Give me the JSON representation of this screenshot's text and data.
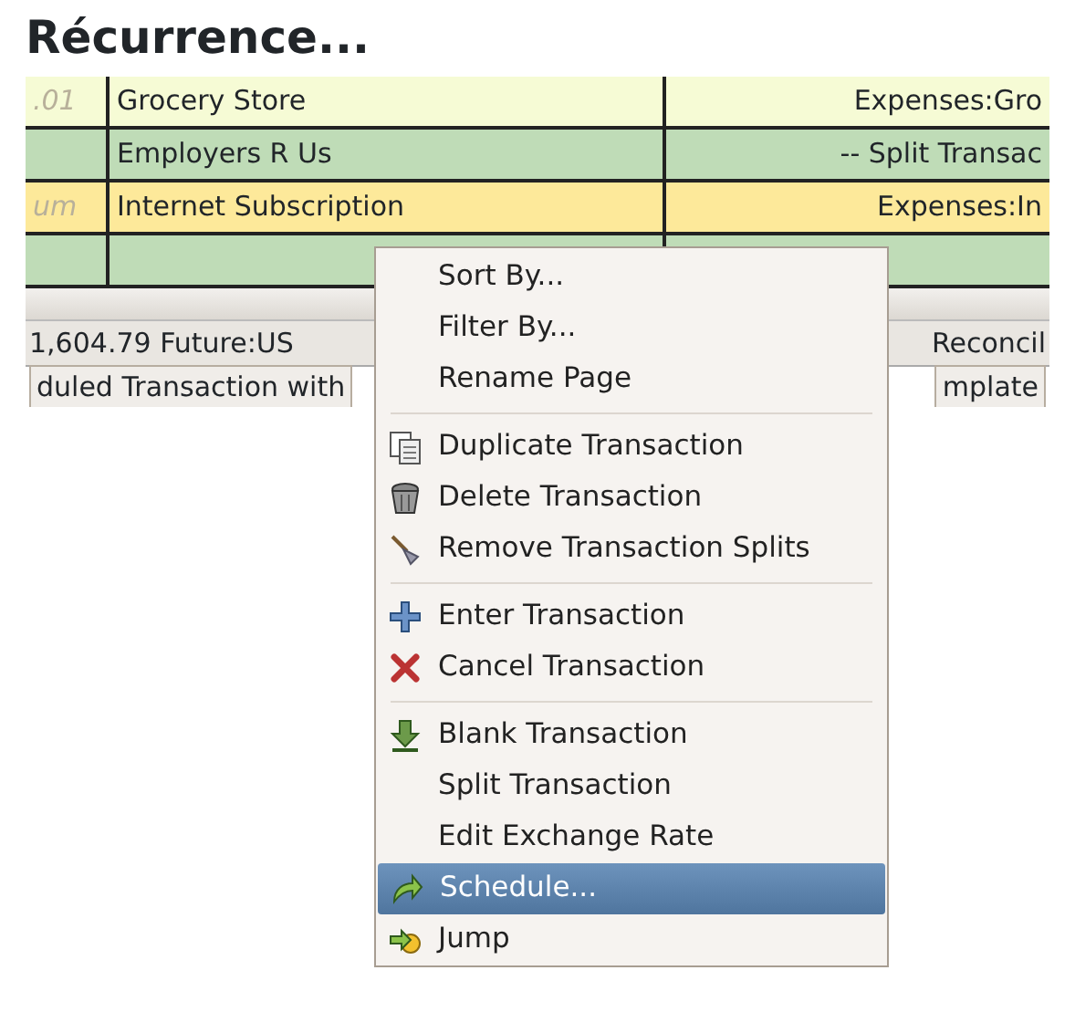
{
  "heading": "Récurrence...",
  "register": {
    "rows": [
      {
        "cells": [
          ".01",
          "Grocery Store",
          "Expenses:Gro"
        ],
        "selected": false
      },
      {
        "cells": [
          "",
          "Employers R Us",
          "-- Split Transac"
        ],
        "selected": false
      },
      {
        "cells": [
          "um",
          "Internet Subscription",
          "Expenses:In"
        ],
        "selected": true
      },
      {
        "cells": [
          "",
          "",
          ""
        ],
        "selected": false
      }
    ],
    "summary": {
      "left": "1,604.79  Future:US",
      "right": "Reconcil"
    },
    "status": {
      "left": "duled Transaction with",
      "right": "mplate"
    }
  },
  "menu": {
    "groups": [
      [
        {
          "label": "Sort By...",
          "selected": false
        },
        {
          "label": "Filter By...",
          "selected": false
        },
        {
          "label": "Rename Page",
          "selected": false
        }
      ],
      [
        {
          "label": "Duplicate Transaction",
          "selected": false
        },
        {
          "label": "Delete Transaction",
          "selected": false
        },
        {
          "label": "Remove Transaction Splits",
          "selected": false
        }
      ],
      [
        {
          "label": "Enter Transaction",
          "selected": false
        },
        {
          "label": "Cancel Transaction",
          "selected": false
        }
      ],
      [
        {
          "label": "Blank Transaction",
          "selected": false
        },
        {
          "label": "Split Transaction",
          "selected": false
        },
        {
          "label": "Edit Exchange Rate",
          "selected": false
        },
        {
          "label": "Schedule...",
          "selected": true
        },
        {
          "label": "Jump",
          "selected": false
        }
      ]
    ]
  }
}
